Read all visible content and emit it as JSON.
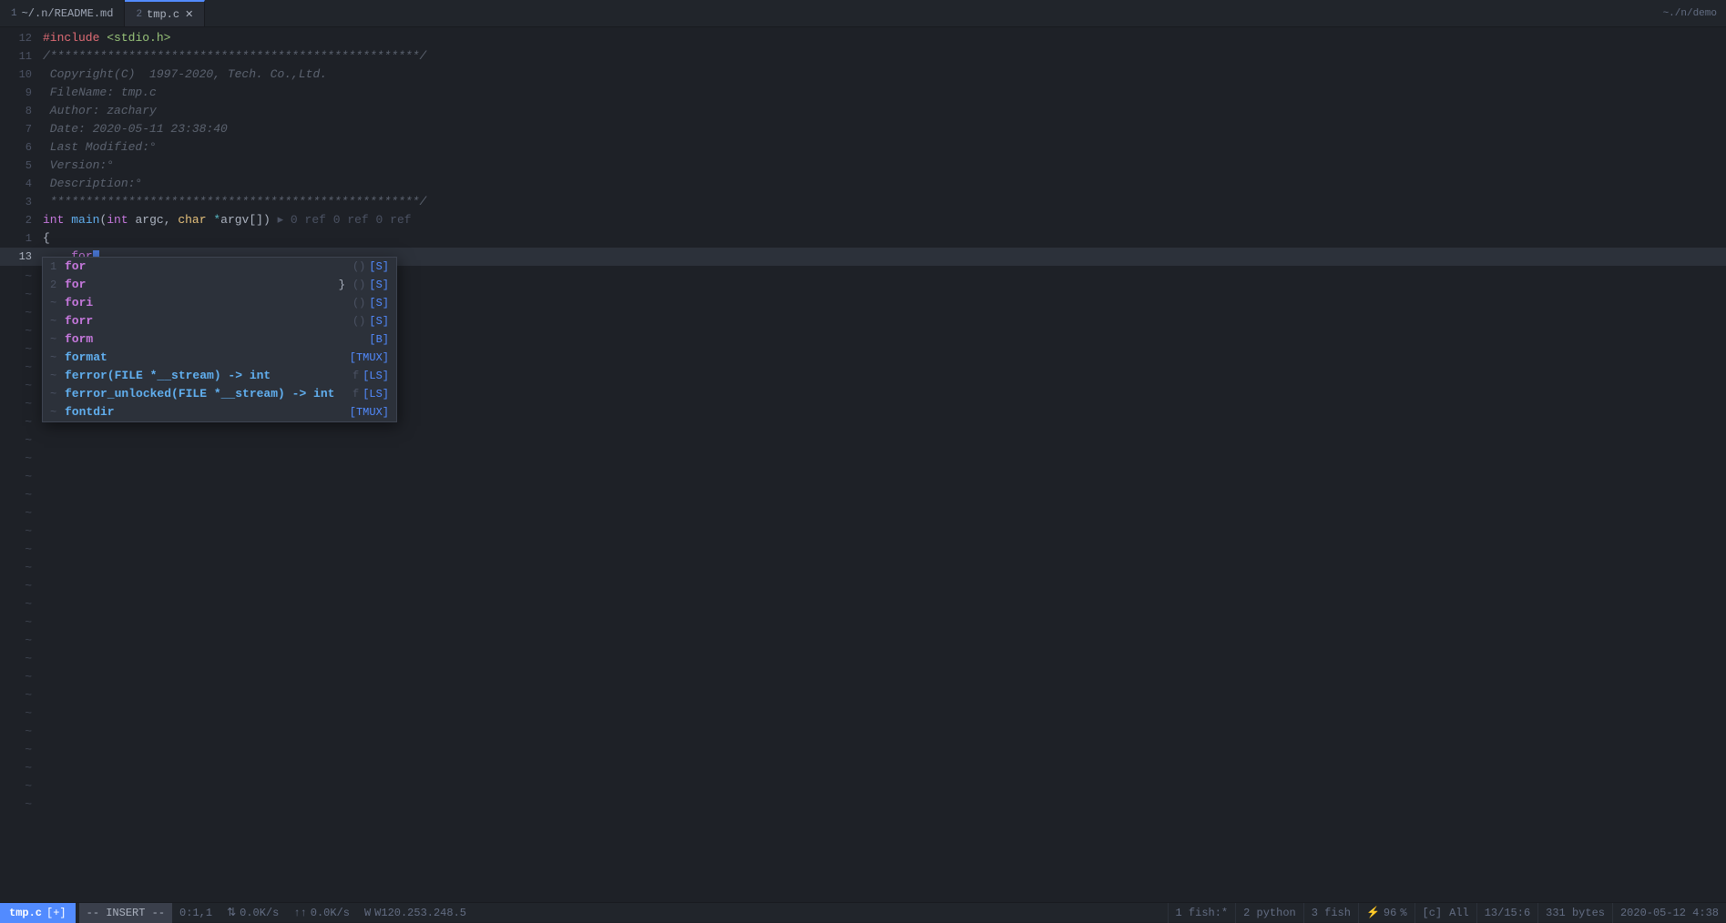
{
  "tabs": [
    {
      "num": "1",
      "label": "~/.n/README.md",
      "active": false,
      "modified": false
    },
    {
      "num": "2",
      "label": "tmp.c",
      "active": true,
      "modified": true
    }
  ],
  "tab_bar_right": "~./n/demo",
  "code": [
    {
      "num": "12",
      "content": "#include <stdio.h>",
      "type": "preprocessor"
    },
    {
      "num": "11",
      "content": "/****************************************************/",
      "type": "comment"
    },
    {
      "num": "10",
      "content": " Copyright(C)  1997-2020, Tech. Co.,Ltd.",
      "type": "comment"
    },
    {
      "num": "9",
      "content": " FileName: tmp.c",
      "type": "comment"
    },
    {
      "num": "8",
      "content": " Author: zachary",
      "type": "comment"
    },
    {
      "num": "7",
      "content": " Date: 2020-05-11 23:38:40",
      "type": "comment"
    },
    {
      "num": "6",
      "content": " Last Modified:°",
      "type": "comment"
    },
    {
      "num": "5",
      "content": " Version:°",
      "type": "comment"
    },
    {
      "num": "4",
      "content": " Description:°",
      "type": "comment"
    },
    {
      "num": "3",
      "content": " ****************************************************/",
      "type": "comment"
    },
    {
      "num": "2",
      "content": "int main(int argc, char *argv[]) ▸ 0 ref 0 ref 0 ref",
      "type": "main_decl"
    },
    {
      "num": "1",
      "content": "{",
      "type": "plain"
    },
    {
      "num": "13",
      "content": "    for█",
      "type": "current",
      "is_current": true
    }
  ],
  "autocomplete": {
    "items": [
      {
        "num": "1",
        "label": "for",
        "detail": "",
        "kind": "()",
        "src": "[S]"
      },
      {
        "num": "2",
        "label": "for",
        "detail": "}",
        "kind": "()",
        "src": "[S]"
      },
      {
        "num": "~",
        "label": "fori",
        "detail": "",
        "kind": "()",
        "src": "[S]"
      },
      {
        "num": "~",
        "label": "forr",
        "detail": "",
        "kind": "()",
        "src": "[S]"
      },
      {
        "num": "~",
        "label": "form",
        "detail": "",
        "kind": "",
        "src": "[B]"
      },
      {
        "num": "~",
        "label": "format",
        "detail": "",
        "kind": "",
        "src": "[TMUX]"
      },
      {
        "num": "~",
        "label": "ferror(FILE *__stream) -> int",
        "detail": "",
        "kind": "f",
        "src": "[LS]"
      },
      {
        "num": "~",
        "label": "ferror_unlocked(FILE *__stream) -> int",
        "detail": "",
        "kind": "f",
        "src": "[LS]"
      },
      {
        "num": "~",
        "label": "fontdir",
        "detail": "",
        "kind": "",
        "src": "[TMUX]"
      }
    ]
  },
  "status": {
    "file": "tmp.c",
    "new_flag": "[+]",
    "mode": "-- INSERT --",
    "pos": "0:1,1",
    "arrows": "⇅ ⇄",
    "down_speed": "0.0K/s",
    "up_arrow": "↑↑",
    "up_speed": "0.0K/s",
    "ip": "W120.253.248.5",
    "encoding": "[c]",
    "filetype": "All",
    "line_info": "13/15:6",
    "bytes": "331 bytes",
    "fish1": "1 fish:*",
    "fish2": "2 python",
    "fish3": "3 fish",
    "cpu_pct": "96",
    "datetime": "2020-05-12  4:38"
  }
}
